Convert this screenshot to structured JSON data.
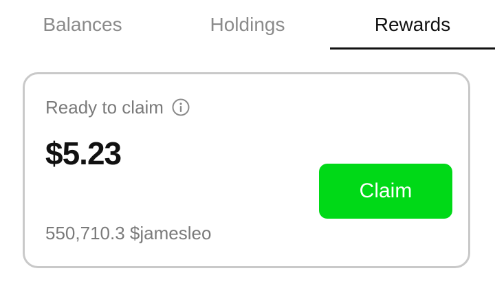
{
  "tabs": [
    {
      "label": "Balances",
      "active": false
    },
    {
      "label": "Holdings",
      "active": false
    },
    {
      "label": "Rewards",
      "active": true
    }
  ],
  "rewards": {
    "ready_label": "Ready to claim",
    "info_icon": "info-icon",
    "amount": "$5.23",
    "token_amount": "550,710.3 $jamesleo",
    "claim_label": "Claim"
  },
  "colors": {
    "accent_green": "#00d917",
    "active_tab": "#111111",
    "inactive_tab": "#8a8a8a",
    "card_border": "#c9c9c9"
  }
}
